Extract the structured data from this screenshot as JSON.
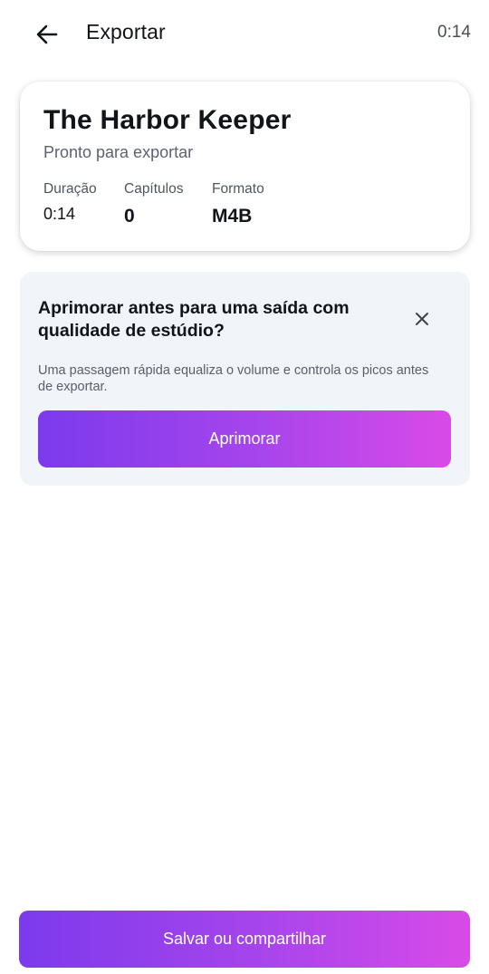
{
  "header": {
    "back_icon": "arrow-left-icon",
    "title": "Exportar",
    "time": "0:14"
  },
  "summary": {
    "book_title": "The Harbor Keeper",
    "status": "Pronto para exportar",
    "stats": {
      "duration": {
        "label": "Duração",
        "value": "0:14"
      },
      "chapters": {
        "label": "Capítulos",
        "value": "0"
      },
      "format": {
        "label": "Formato",
        "value": "M4B"
      }
    }
  },
  "enhance": {
    "title": "Aprimorar antes para uma saída com qualidade de estúdio?",
    "close_icon": "close-icon",
    "description": "Uma passagem rápida equaliza o volume e controla os picos antes de exportar.",
    "button_label": "Aprimorar"
  },
  "footer": {
    "save_label": "Salvar ou compartilhar"
  },
  "colors": {
    "accent_start": "#7c3aed",
    "accent_end": "#d94ae8",
    "card_bg": "#f1f4f8"
  }
}
